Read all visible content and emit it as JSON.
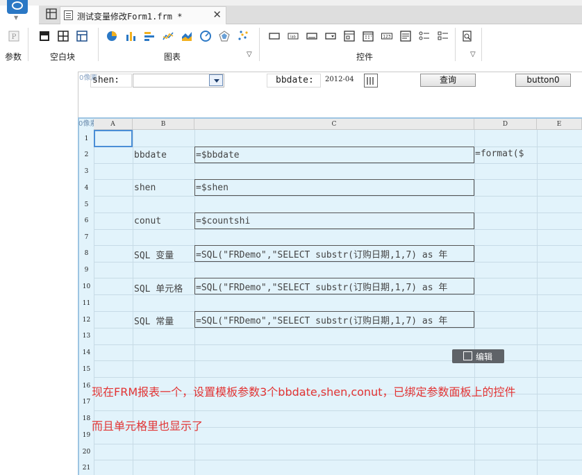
{
  "tabs": {
    "file_title": "测试变量修改Form1.frm *",
    "close_glyph": "✕"
  },
  "ribbon": {
    "groups": [
      {
        "label": "参数"
      },
      {
        "label": "空白块"
      },
      {
        "label": "图表"
      },
      {
        "label": "控件"
      }
    ]
  },
  "params_panel": {
    "size_hint": "0像素",
    "shen_label": "shen:",
    "shen_value": "",
    "bbdate_label": "bbdate:",
    "bbdate_value": "2012-04",
    "query_button": "查询",
    "button0": "button0"
  },
  "sheet": {
    "size_hint": "0像素",
    "columns": [
      "A",
      "B",
      "C",
      "D",
      "E"
    ],
    "rows": [
      "1",
      "2",
      "3",
      "4",
      "5",
      "6",
      "7",
      "8",
      "9",
      "10",
      "11",
      "12",
      "13",
      "14",
      "15",
      "16",
      "17",
      "18",
      "19",
      "20",
      "21"
    ],
    "cells": {
      "b2": "bbdate",
      "c2": "=$bbdate",
      "d2": "=format($",
      "b4": "shen",
      "c4": "=$shen",
      "b6": "conut",
      "c6": "=$countshi",
      "b8": "SQL 变量",
      "c8": "=SQL(\"FRDemo\",\"SELECT substr(订购日期,1,7) as 年",
      "b10": "SQL 单元格",
      "c10": "=SQL(\"FRDemo\",\"SELECT substr(订购日期,1,7) as 年",
      "b12": "SQL 常量",
      "c12": "=SQL(\"FRDemo\",\"SELECT substr(订购日期,1,7) as 年"
    },
    "edit_button": "编辑"
  },
  "annotations": {
    "line1": "现在FRM报表一个，设置模板参数3个bbdate,shen,conut，已绑定参数面板上的控件",
    "line2": "而且单元格里也显示了"
  },
  "colors": {
    "accent": "#2b78c5",
    "annotation": "#e23434",
    "sheet_bg": "#e2f3fb"
  }
}
